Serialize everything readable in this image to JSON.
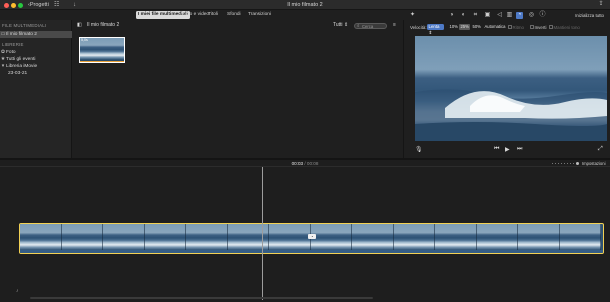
{
  "window": {
    "title": "Il mio filmato 2",
    "back_label": "Progetti",
    "toolbar_icons": [
      "media-icon",
      "download-icon"
    ],
    "share_icon": "share-icon"
  },
  "tabs": [
    {
      "label": "I miei file multimediali",
      "active": true
    },
    {
      "label": "Audio e video",
      "active": false
    },
    {
      "label": "Titoli",
      "active": false
    },
    {
      "label": "Sfondi",
      "active": false
    },
    {
      "label": "Transizioni",
      "active": false
    }
  ],
  "sidebar": {
    "section_media": "FILE MULTIMEDIALI",
    "project_item": "Il mio filmato 2",
    "section_libraries": "LIBRERIE",
    "photos": "Foto",
    "all_events": "Tutti gli eventi",
    "library": "Libreria iMovie",
    "event_date": "23-03-21"
  },
  "browser": {
    "title": "Il mio filmato 2",
    "filter_label": "Tutti",
    "search_placeholder": "Cerca",
    "clip_duration": "5,0s"
  },
  "viewer": {
    "reset_all": "Inizializza tutto",
    "speed_label": "Velocità:",
    "speed_value": "Lenta",
    "speed_options": [
      {
        "label": "10%",
        "selected": false
      },
      {
        "label": "25%",
        "selected": true
      },
      {
        "label": "50%",
        "selected": false
      },
      {
        "label": "Automatica",
        "selected": false
      }
    ],
    "reverse_label": "Ritmo",
    "invert_label": "Inverti",
    "preserve_label": "Mantieni tono",
    "tool_icons": [
      "magic-wand-icon",
      "color-balance-icon",
      "color-correction-icon",
      "crop-icon",
      "stabilization-icon",
      "volume-icon",
      "noise-reduction-icon",
      "speed-icon",
      "filter-icon",
      "info-icon"
    ]
  },
  "playback": {
    "current_time": "00:03",
    "separator": "/",
    "total_time": "00:08"
  },
  "timeline": {
    "settings_label": "Impostazioni"
  }
}
